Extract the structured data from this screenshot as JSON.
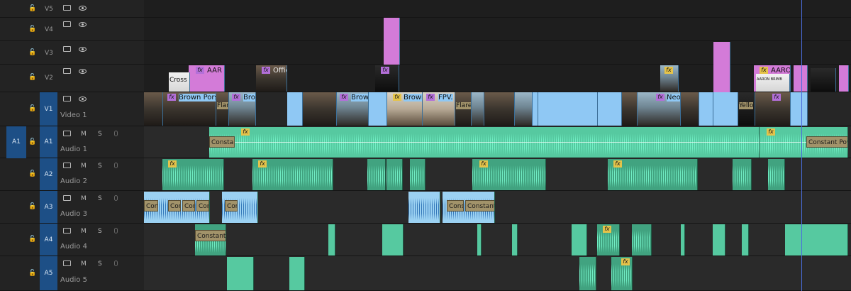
{
  "tracks": {
    "v5": {
      "id": "V5",
      "name": ""
    },
    "v4": {
      "id": "V4",
      "name": ""
    },
    "v3": {
      "id": "V3",
      "name": ""
    },
    "v2": {
      "id": "V2",
      "name": ""
    },
    "v1": {
      "id": "V1",
      "name": "Video 1"
    },
    "a1": {
      "source": "A1",
      "id": "A1",
      "name": "Audio 1",
      "m": "M",
      "s": "S"
    },
    "a2": {
      "id": "A2",
      "name": "Audio 2",
      "m": "M",
      "s": "S"
    },
    "a3": {
      "id": "A3",
      "name": "Audio 3",
      "m": "M",
      "s": "S"
    },
    "a4": {
      "id": "A4",
      "name": "Audio 4",
      "m": "M",
      "s": "S"
    },
    "a5": {
      "id": "A5",
      "name": "Audio 5",
      "m": "M",
      "s": "S"
    }
  },
  "clips": {
    "v2_1": "AAR",
    "v2_title1": "Cross",
    "v2_2": "Offic",
    "v2_3": "AARO",
    "v2_title2": "AARON BRIMB",
    "v1_1": "Brown Porsch",
    "v1_2": "Bro",
    "v1_3": "Brow",
    "v1_4": "Brown",
    "v1_5": "FPV.",
    "v1_6": "Neo",
    "v1_7": "Flar",
    "v1_8": "Flare",
    "v1_9": "Yello",
    "a1_const1": "Constan",
    "a1_const2": "Constant Power",
    "a3_1": "Con",
    "a3_2": "Con",
    "a3_3": "Con",
    "a3_4": "Con",
    "a3_5": "Con",
    "a3_6": "Consta",
    "a3_7": "Constant",
    "a4_const": "Constant Po",
    "fx": "fx"
  }
}
